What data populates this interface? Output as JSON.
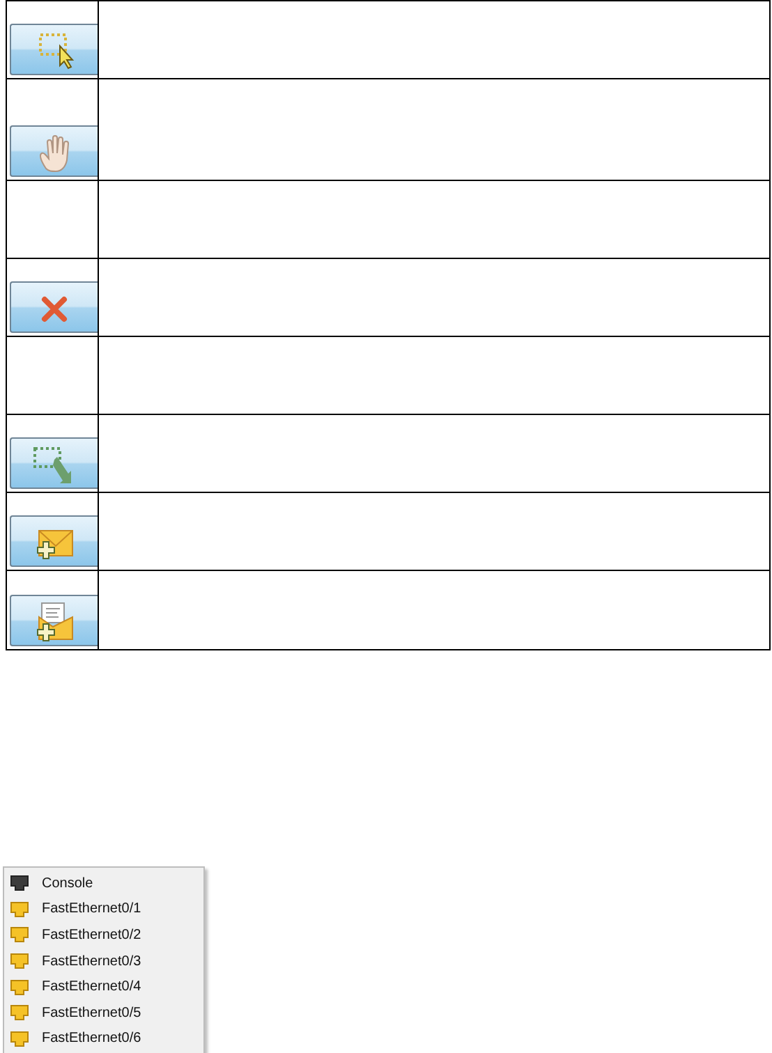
{
  "tools": [
    {
      "kind": "select"
    },
    {
      "kind": "move"
    },
    {
      "kind": "empty"
    },
    {
      "kind": "delete"
    },
    {
      "kind": "empty"
    },
    {
      "kind": "resize"
    },
    {
      "kind": "simple-pdu"
    },
    {
      "kind": "complex-pdu"
    }
  ],
  "port_menu": {
    "items": [
      {
        "label": "Console",
        "kind": "console"
      },
      {
        "label": "FastEthernet0/1",
        "kind": "ethernet"
      },
      {
        "label": "FastEthernet0/2",
        "kind": "ethernet"
      },
      {
        "label": "FastEthernet0/3",
        "kind": "ethernet"
      },
      {
        "label": "FastEthernet0/4",
        "kind": "ethernet"
      },
      {
        "label": "FastEthernet0/5",
        "kind": "ethernet"
      },
      {
        "label": "FastEthernet0/6",
        "kind": "ethernet"
      }
    ]
  }
}
